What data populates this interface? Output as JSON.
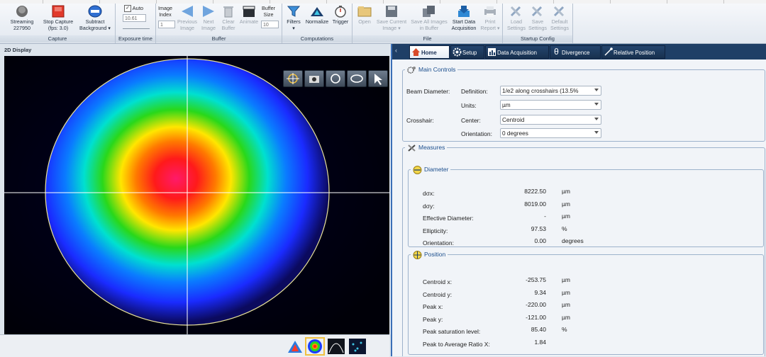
{
  "ribbon": {
    "capture": {
      "group_label": "Capture",
      "streaming_label": "Streaming",
      "streaming_value": "227950",
      "stop_capture_label": "Stop Capture",
      "fps_label": "(fps: 3.0)",
      "subtract_label": "Subtract",
      "background_label": "Background"
    },
    "exposure": {
      "group_label": "Exposure time",
      "auto_label": "Auto",
      "value": "10.61"
    },
    "buffer": {
      "group_label": "Buffer",
      "image_index_label1": "Image",
      "image_index_label2": "Index",
      "image_index_value": "1",
      "previous_label1": "Previous",
      "previous_label2": "Image",
      "next_label1": "Next",
      "next_label2": "Image",
      "clear_label1": "Clear",
      "clear_label2": "Buffer",
      "animate_label": "Animate",
      "buffer_size_label1": "Buffer",
      "buffer_size_label2": "Size",
      "buffer_size_value": "10"
    },
    "computations": {
      "group_label": "Computations",
      "filters_label": "Filters",
      "normalize_label": "Normalize",
      "trigger_label": "Trigger"
    },
    "file": {
      "group_label": "File",
      "open_label": "Open",
      "save_current_label1": "Save Current",
      "save_current_label2": "Image",
      "save_all_label1": "Save All Images",
      "save_all_label2": "in Buffer",
      "start_data_label1": "Start Data",
      "start_data_label2": "Acquisition",
      "print_label1": "Print",
      "print_label2": "Report"
    },
    "startup": {
      "group_label": "Startup Config",
      "load_label1": "Load",
      "load_label2": "Settings",
      "save_label1": "Save",
      "save_label2": "Settings",
      "default_label1": "Default",
      "default_label2": "Settings"
    }
  },
  "display": {
    "title": "2D Display"
  },
  "tabs": [
    {
      "label": "Home"
    },
    {
      "label": "Setup"
    },
    {
      "label": "Data Acquisition"
    },
    {
      "label": "Divergence"
    },
    {
      "label": "Relative Position"
    }
  ],
  "main_controls": {
    "title": "Main Controls",
    "beam_diameter_label": "Beam Diameter:",
    "definition_label": "Definition:",
    "definition_value": "1/e2 along crosshairs (13.5%",
    "units_label": "Units:",
    "units_value": "µm",
    "crosshair_label": "Crosshair:",
    "center_label": "Center:",
    "center_value": "Centroid",
    "orientation_label": "Orientation:",
    "orientation_value": "0 degrees"
  },
  "measures": {
    "title": "Measures",
    "diameter": {
      "title": "Diameter",
      "rows": [
        {
          "label": "dσx:",
          "value": "8222.50",
          "unit": "µm"
        },
        {
          "label": "dσy:",
          "value": "8019.00",
          "unit": "µm"
        },
        {
          "label": "Effective Diameter:",
          "value": "-",
          "unit": "µm"
        },
        {
          "label": "Ellipticity:",
          "value": "97.53",
          "unit": "%"
        },
        {
          "label": "Orientation:",
          "value": "0.00",
          "unit": "degrees"
        }
      ]
    },
    "position": {
      "title": "Position",
      "rows": [
        {
          "label": "Centroid x:",
          "value": "-253.75",
          "unit": "µm"
        },
        {
          "label": "Centroid y:",
          "value": "9.34",
          "unit": "µm"
        },
        {
          "label": "Peak x:",
          "value": "-220.00",
          "unit": "µm"
        },
        {
          "label": "Peak y:",
          "value": "-121.00",
          "unit": "µm"
        },
        {
          "label": "Peak saturation level:",
          "value": "85.40",
          "unit": "%"
        },
        {
          "label": "Peak to Average Ratio X:",
          "value": "1.84",
          "unit": ""
        }
      ]
    }
  },
  "colors": {
    "accent": "#1f3f66",
    "legend_text": "#1c4f8e"
  }
}
